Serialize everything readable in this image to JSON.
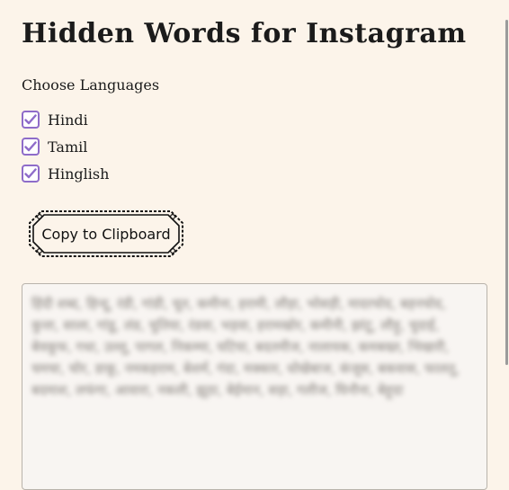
{
  "page": {
    "title": "Hidden Words for Instagram",
    "section_label": "Choose Languages"
  },
  "languages": [
    {
      "label": "Hindi",
      "checked": true
    },
    {
      "label": "Tamil",
      "checked": true
    },
    {
      "label": "Hinglish",
      "checked": true
    }
  ],
  "copy_button": {
    "label": "Copy to Clipboard"
  },
  "output": {
    "text": "हिंदी शब्द, हिन्दू, रंडी, गांडी, चूत, कमीना, हरामी, लौड़ा, भोसड़ी, मादरचोद, बहनचोद, कुत्ता, साला, गांडू, लंड, चुतिया, रंडवा, भड़वा, हरामखोर, कमीनी, झांटू, लौड़ू, चुदाई, बेवकूफ, गधा, उल्लू, पागल, निकम्मा, घटिया, बदतमीज, नालायक, कमबख्त, भिखारी, चमचा, चोर, डाकू, नमकहराम, बेशर्म, गंदा, मक्कार, धोखेबाज, कंजूस, बकवास, फालतू, बदमाश, लफंगा, आवारा, नकली, झूठा, बेईमान, सड़ा, गलीज, घिनौना, बेहूदा"
  },
  "colors": {
    "background": "#fcf4ea",
    "checkbox_accent": "#8e6cc9",
    "output_bg": "#f8f5f2",
    "output_border": "#b9b3ab"
  }
}
